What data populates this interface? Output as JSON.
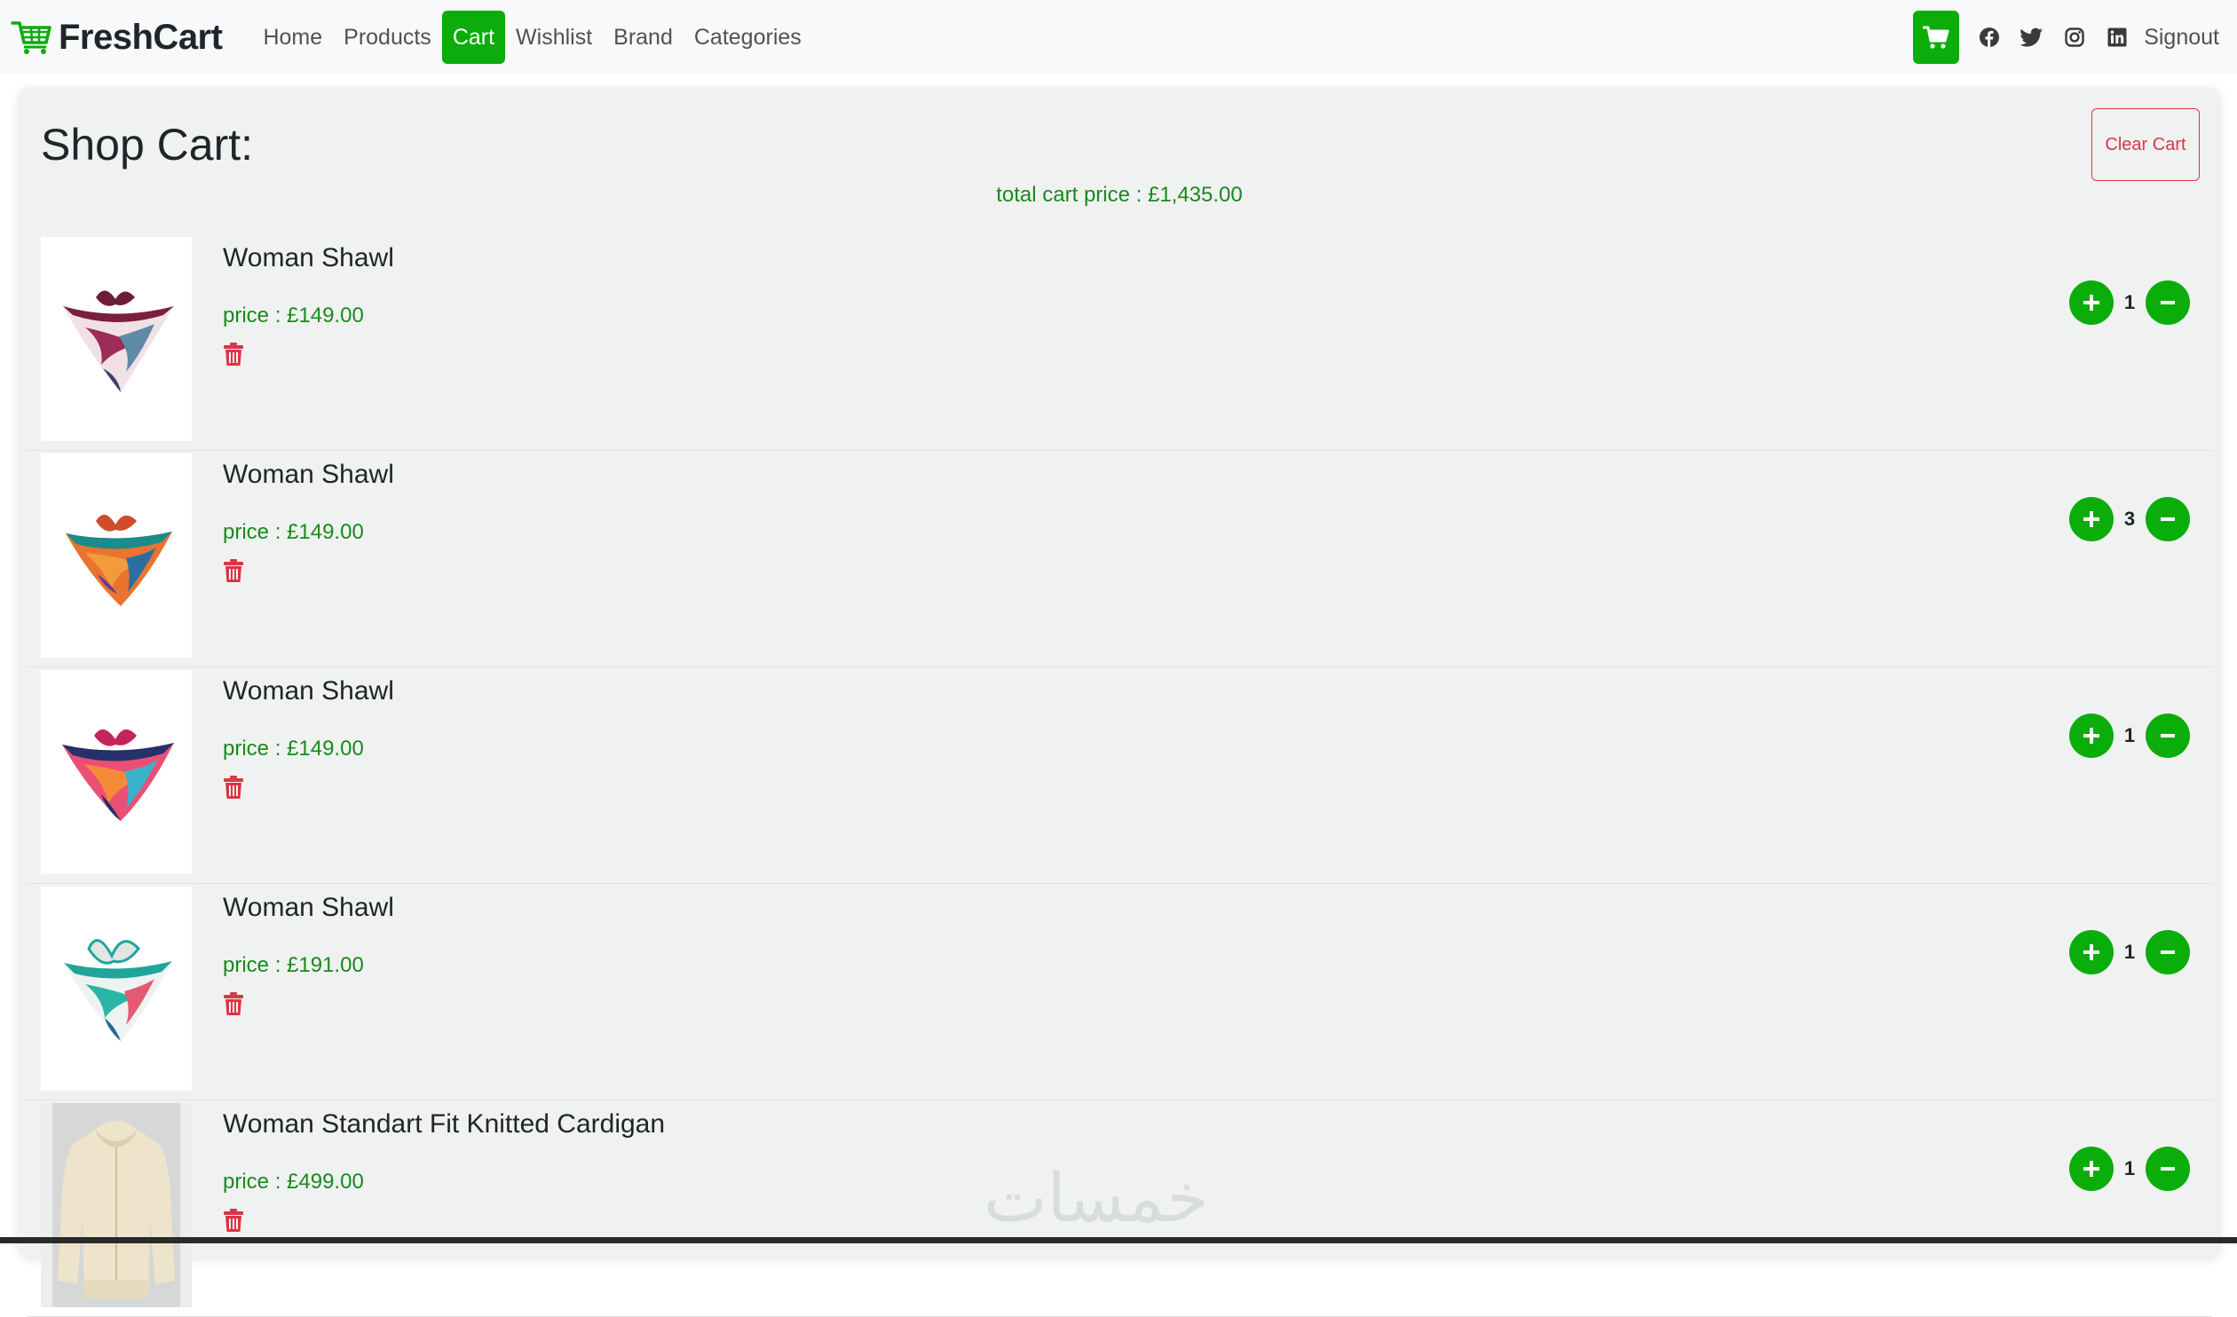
{
  "navbar": {
    "brand": "FreshCart",
    "links": [
      "Home",
      "Products",
      "Cart",
      "Wishlist",
      "Brand",
      "Categories"
    ],
    "active_link": "Cart",
    "signout": "Signout",
    "social_icons": [
      "facebook-icon",
      "twitter-icon",
      "instagram-icon",
      "linkedin-icon"
    ]
  },
  "cart": {
    "title": "Shop Cart:",
    "clear_label": "Clear Cart",
    "total_label": "total cart price :",
    "total_value": "£1,435.00",
    "price_label": "price :",
    "items": [
      {
        "name": "Woman Shawl",
        "price": "£149.00",
        "qty": "1"
      },
      {
        "name": "Woman Shawl",
        "price": "£149.00",
        "qty": "3"
      },
      {
        "name": "Woman Shawl",
        "price": "£149.00",
        "qty": "1"
      },
      {
        "name": "Woman Shawl",
        "price": "£191.00",
        "qty": "1"
      },
      {
        "name": "Woman Standart Fit Knitted Cardigan",
        "price": "£499.00",
        "qty": "1"
      }
    ]
  },
  "watermark": "خمسات",
  "colors": {
    "brand_green": "#0aad0a",
    "price_green": "#198a1b",
    "danger": "#dc3545",
    "panel_bg": "#f0f2f1",
    "navbar_bg": "#f8f9fa"
  }
}
